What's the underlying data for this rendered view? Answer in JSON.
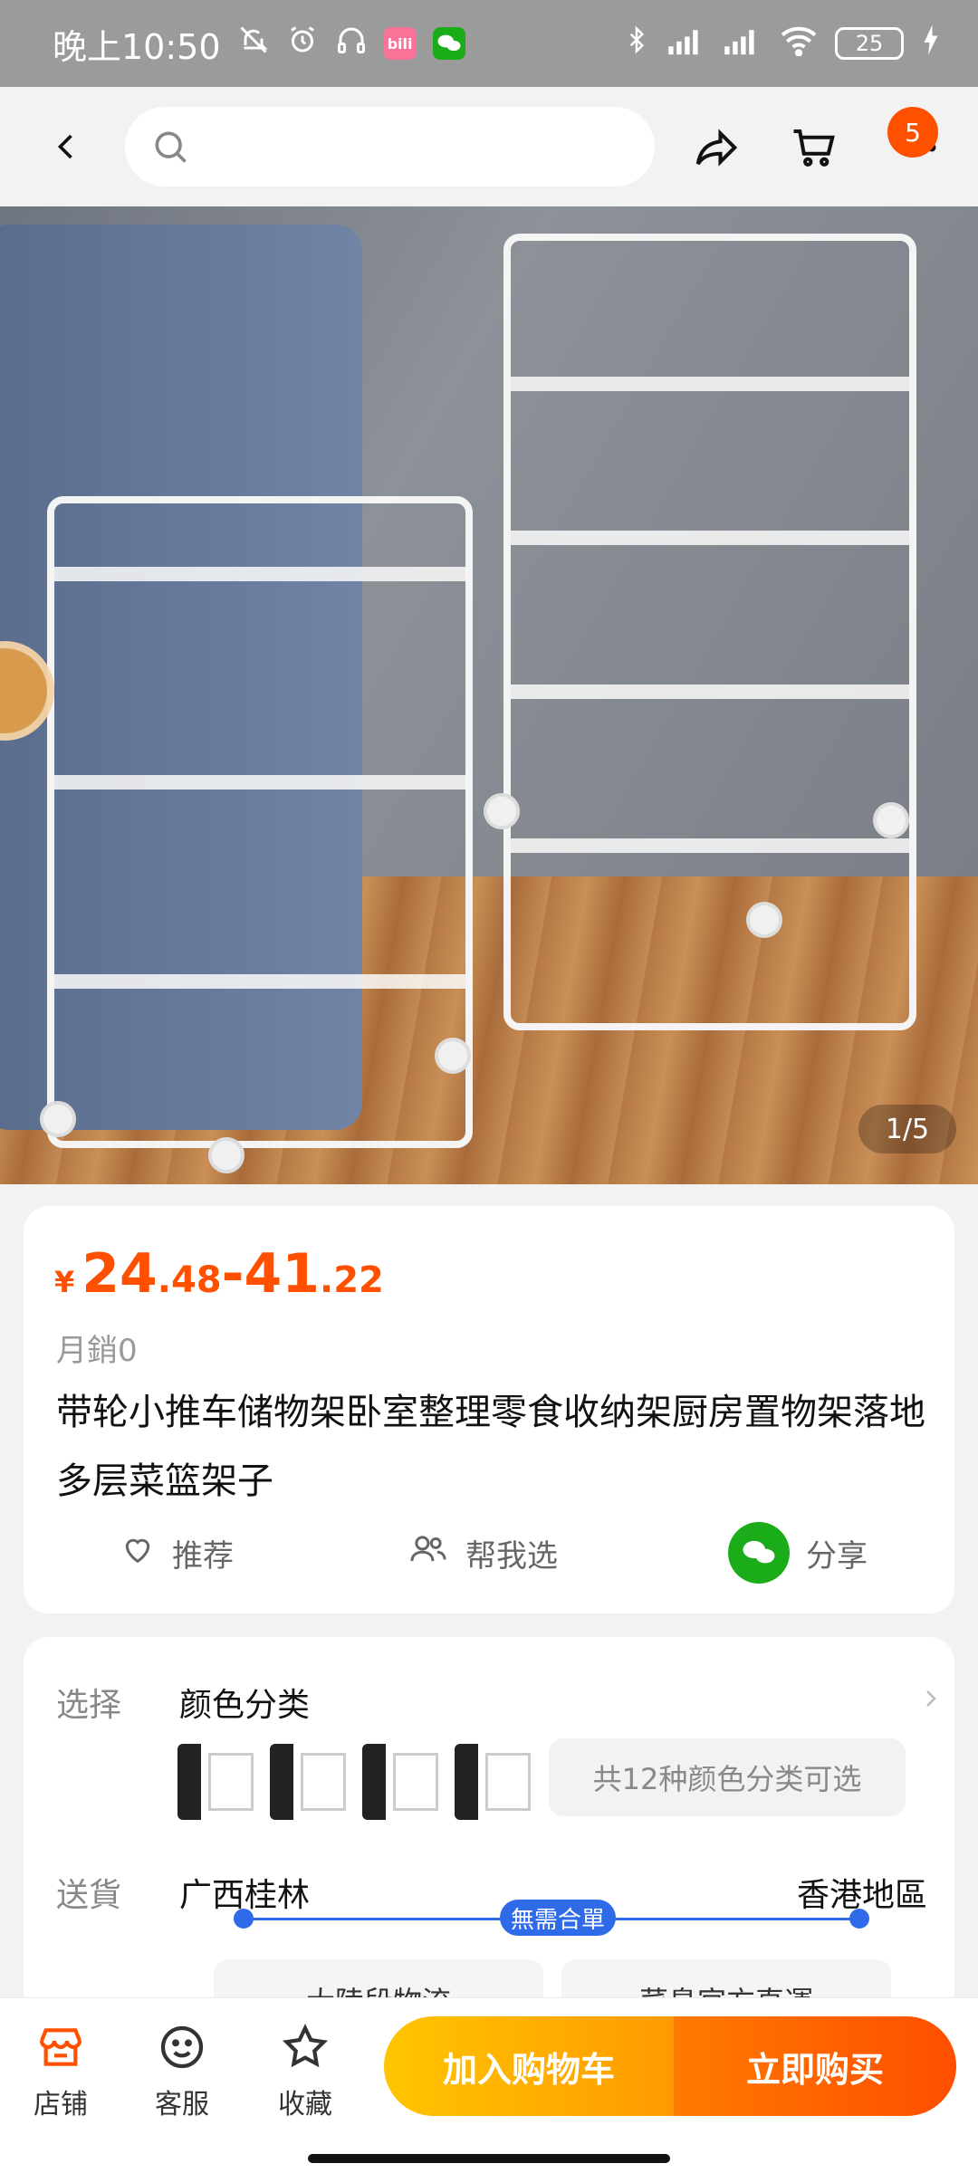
{
  "status_bar": {
    "time": "晚上10:50",
    "battery": "25",
    "notification_icons": [
      "mute-icon",
      "alarm-icon",
      "headset-icon",
      "bilibili-icon",
      "wechat-icon"
    ],
    "system_icons": [
      "bluetooth-icon",
      "signal-icon",
      "signal-roaming-icon",
      "wifi-icon",
      "charging-icon"
    ],
    "bilibili_label": "bili"
  },
  "top_nav": {
    "search_placeholder": "",
    "cart_badge": "5"
  },
  "hero": {
    "page_indicator": "1/5"
  },
  "product": {
    "price_currency": "¥",
    "price_low_int": "24",
    "price_low_dec": ".48",
    "price_sep": "-",
    "price_high_int": "41",
    "price_high_dec": ".22",
    "monthly_sales": "月銷0",
    "title": "带轮小推车储物架卧室整理零食收纳架厨房置物架落地多层菜篮架子",
    "actions": {
      "recommend": "推荐",
      "help_choose": "帮我选",
      "share": "分享"
    }
  },
  "options": {
    "select_label": "选择",
    "select_value": "颜色分类",
    "more_colors": "共12种颜色分类可选",
    "shipping_label": "送貨",
    "ship_from": "广西桂林",
    "ship_to": "香港地區",
    "route_tag": "無需合單",
    "ship_option_1": "大陸段物流",
    "ship_option_2": "菜鳥官方直運"
  },
  "bottom_bar": {
    "store": "店铺",
    "service": "客服",
    "favorite": "收藏",
    "add_to_cart": "加入购物车",
    "buy_now": "立即购买"
  },
  "colors": {
    "accent": "#ff5000",
    "route_blue": "#2f6be8",
    "cta_yellow": "#ffc500",
    "cta_orange": "#ff4e00"
  }
}
